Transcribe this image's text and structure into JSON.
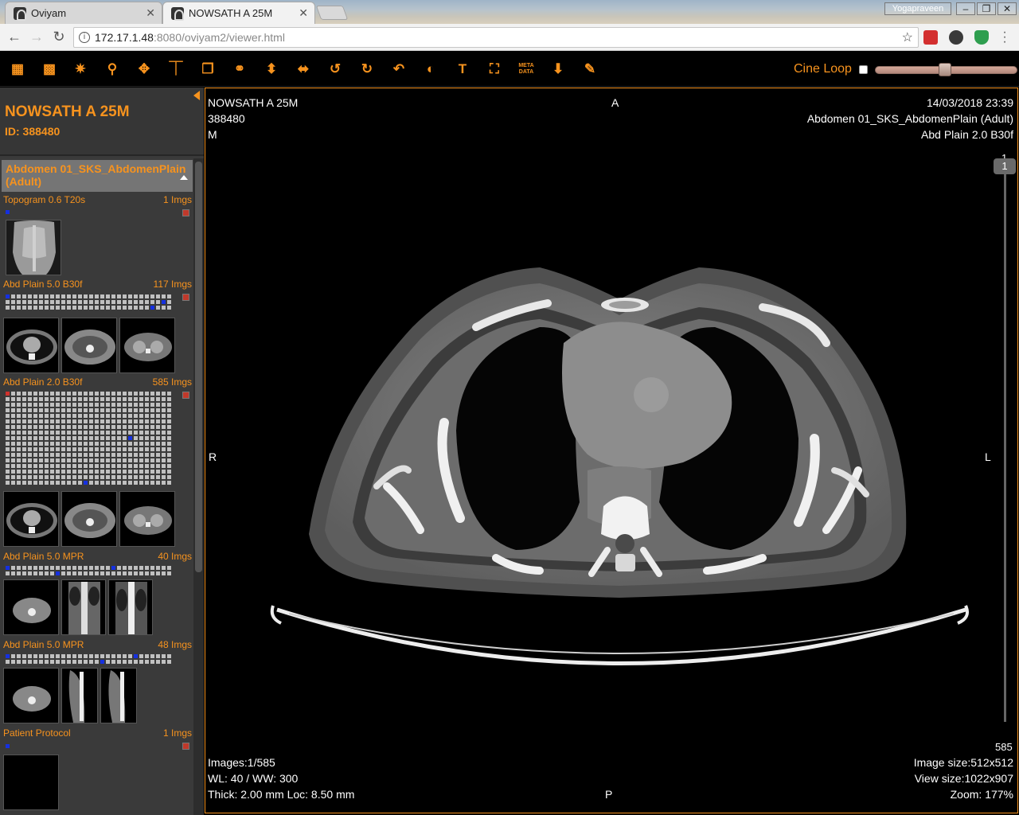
{
  "browser": {
    "tabs": [
      {
        "title": "Oviyam",
        "active": false
      },
      {
        "title": "NOWSATH A 25M",
        "active": true
      }
    ],
    "profile": "Yogapraveen",
    "url_host": "172.17.1.48",
    "url_rest": ":8080/oviyam2/viewer.html"
  },
  "toolbar": {
    "cine_label": "Cine Loop",
    "cine_value": 0.49,
    "meta_label_1": "META",
    "meta_label_2": "DATA",
    "text_tool": "T"
  },
  "patient": {
    "name": "NOWSATH A 25M",
    "id_label": "ID: 388480"
  },
  "study": {
    "title": "Abdomen 01_SKS_AbdomenPlain (Adult)"
  },
  "series": [
    {
      "label": "Topogram 0.6 T20s",
      "count": "1 Imgs"
    },
    {
      "label": "Abd Plain 5.0 B30f",
      "count": "117 Imgs"
    },
    {
      "label": "Abd Plain 2.0 B30f",
      "count": "585 Imgs"
    },
    {
      "label": "Abd Plain 5.0 MPR",
      "count": "40 Imgs"
    },
    {
      "label": "Abd Plain 5.0 MPR",
      "count": "48 Imgs"
    },
    {
      "label": "Patient Protocol",
      "count": "1 Imgs"
    }
  ],
  "viewer": {
    "top_left": [
      "NOWSATH A 25M",
      "388480",
      "M"
    ],
    "top_center": "A",
    "top_right": [
      "14/03/2018 23:39",
      "Abdomen 01_SKS_AbdomenPlain (Adult)",
      "Abd Plain 2.0 B30f"
    ],
    "left_mid": "R",
    "right_mid": "L",
    "bottom_center": "P",
    "bottom_left": [
      "Images:1/585",
      "WL: 40 / WW: 300",
      "Thick: 2.00 mm Loc: 8.50 mm"
    ],
    "bottom_right": [
      "Image size:512x512",
      "View size:1022x907",
      "Zoom: 177%"
    ],
    "scroll_top": "1",
    "scroll_current": "1",
    "scroll_max": "585"
  }
}
